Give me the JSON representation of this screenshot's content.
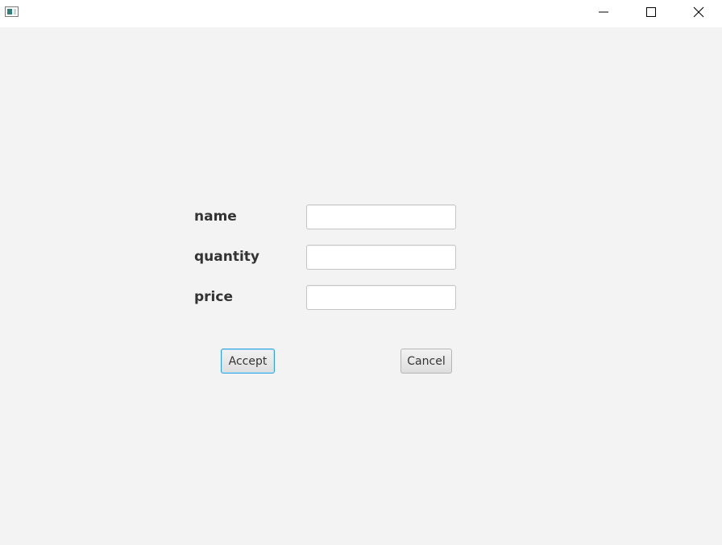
{
  "titlebar": {
    "icons": {
      "app": "window-app-icon",
      "minimize": "minimize-icon",
      "maximize": "maximize-icon",
      "close": "close-icon"
    }
  },
  "form": {
    "fields": [
      {
        "label": "name",
        "value": "",
        "placeholder": ""
      },
      {
        "label": "quantity",
        "value": "",
        "placeholder": ""
      },
      {
        "label": "price",
        "value": "",
        "placeholder": ""
      }
    ],
    "accept_label": "Accept",
    "cancel_label": "Cancel"
  },
  "colors": {
    "background": "#f3f3f3",
    "titlebar": "#ffffff",
    "focus_accent": "#2aa1e0",
    "label_text": "#333333"
  }
}
